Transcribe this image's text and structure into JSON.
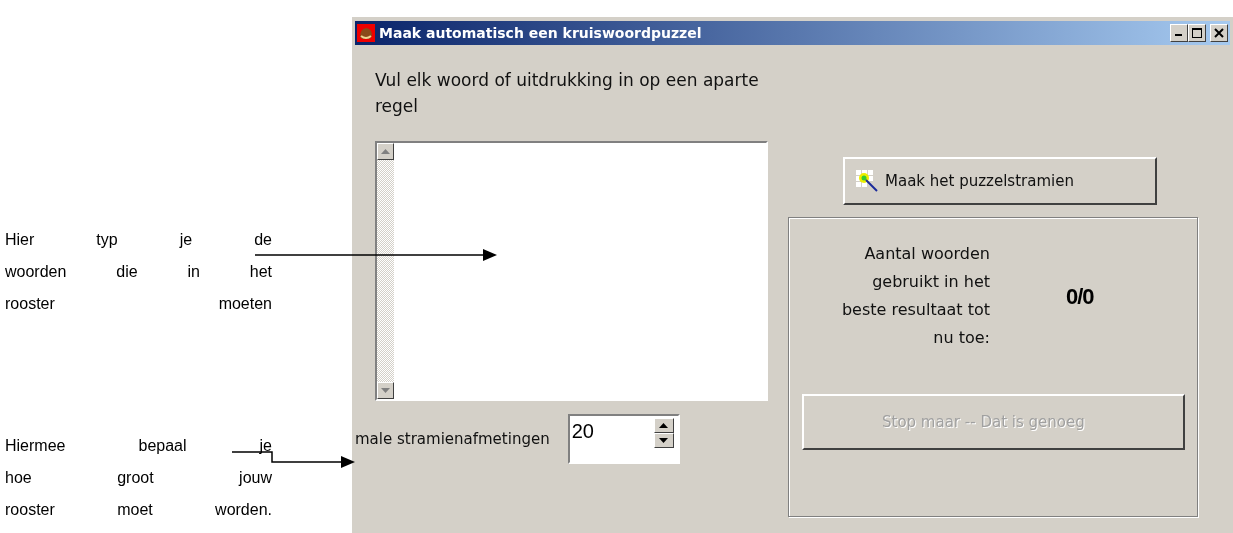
{
  "annotations": [
    {
      "lines": [
        "Hier typ je de",
        "woorden die in het",
        "rooster moeten"
      ]
    },
    {
      "lines": [
        "Hiermee bepaal je",
        "hoe groot jouw",
        "rooster moet worden."
      ]
    }
  ],
  "window": {
    "title": "Maak automatisch een kruiswoordpuzzel"
  },
  "instruction": "Vul elk woord of uitdrukking in op een aparte regel",
  "size": {
    "label": "male stramienafmetingen",
    "value": "20"
  },
  "make_button": {
    "label": "Maak het puzzelstramien",
    "disabled": false
  },
  "result": {
    "label": "Aantal woorden gebruikt in het beste resultaat tot nu toe:",
    "value": "0/0"
  },
  "stop_button": {
    "label": "Stop maar -- Dat is genoeg",
    "disabled": true
  }
}
